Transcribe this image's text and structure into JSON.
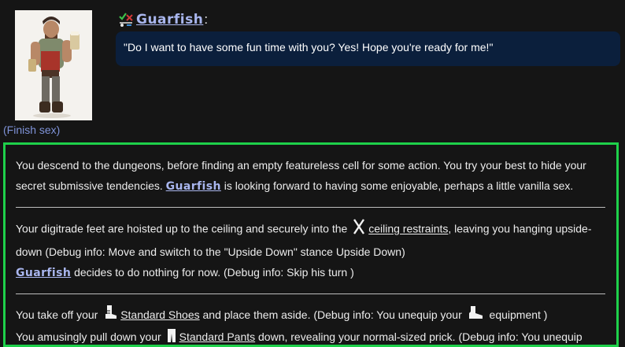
{
  "actions": {
    "finish_sex": "(Finish sex)"
  },
  "dialogue": {
    "speaker": "Guarfish",
    "colon": ":",
    "speech": "\"Do I want to have some fun time with you? Yes! Hope you're ready for me!\""
  },
  "log": {
    "p1": {
      "a": "You descend to the dungeons, before finding an empty featureless cell for some action. You try your best to hide your secret submissive tendencies. ",
      "npc": "Guarfish",
      "b": " is looking forward to having some enjoyable, perhaps a little vanilla sex."
    },
    "p2": {
      "a": "Your digitrade feet are hoisted up to the ceiling and securely into the ",
      "link": "ceiling restraints",
      "b": ", leaving you hanging upside-down (Debug info: Move and switch to the \"Upside Down\" stance Upside Down)"
    },
    "p3": {
      "npc": "Guarfish",
      "b": " decides to do nothing for now. (Debug info: Skip his turn )"
    },
    "p4": {
      "a": "You take off your ",
      "link": "Standard Shoes",
      "b": " and place them aside. (Debug info: You unequip your ",
      "c": " equipment )"
    },
    "p5": {
      "a": "You amusingly pull down your ",
      "link": "Standard Pants",
      "b": " down, revealing your normal-sized prick. (Debug info: You unequip"
    }
  },
  "colors": {
    "speech_bg": "#0b1f3c",
    "log_border": "#1ed04a",
    "npc_name": "#a9b6ee",
    "link": "#7f93d8"
  },
  "icons": {
    "speaker": "mood-check-icon",
    "restraint": "x-restraint-icon",
    "shoe": "shoe-icon",
    "boot": "boot-icon",
    "pants": "pants-icon"
  }
}
